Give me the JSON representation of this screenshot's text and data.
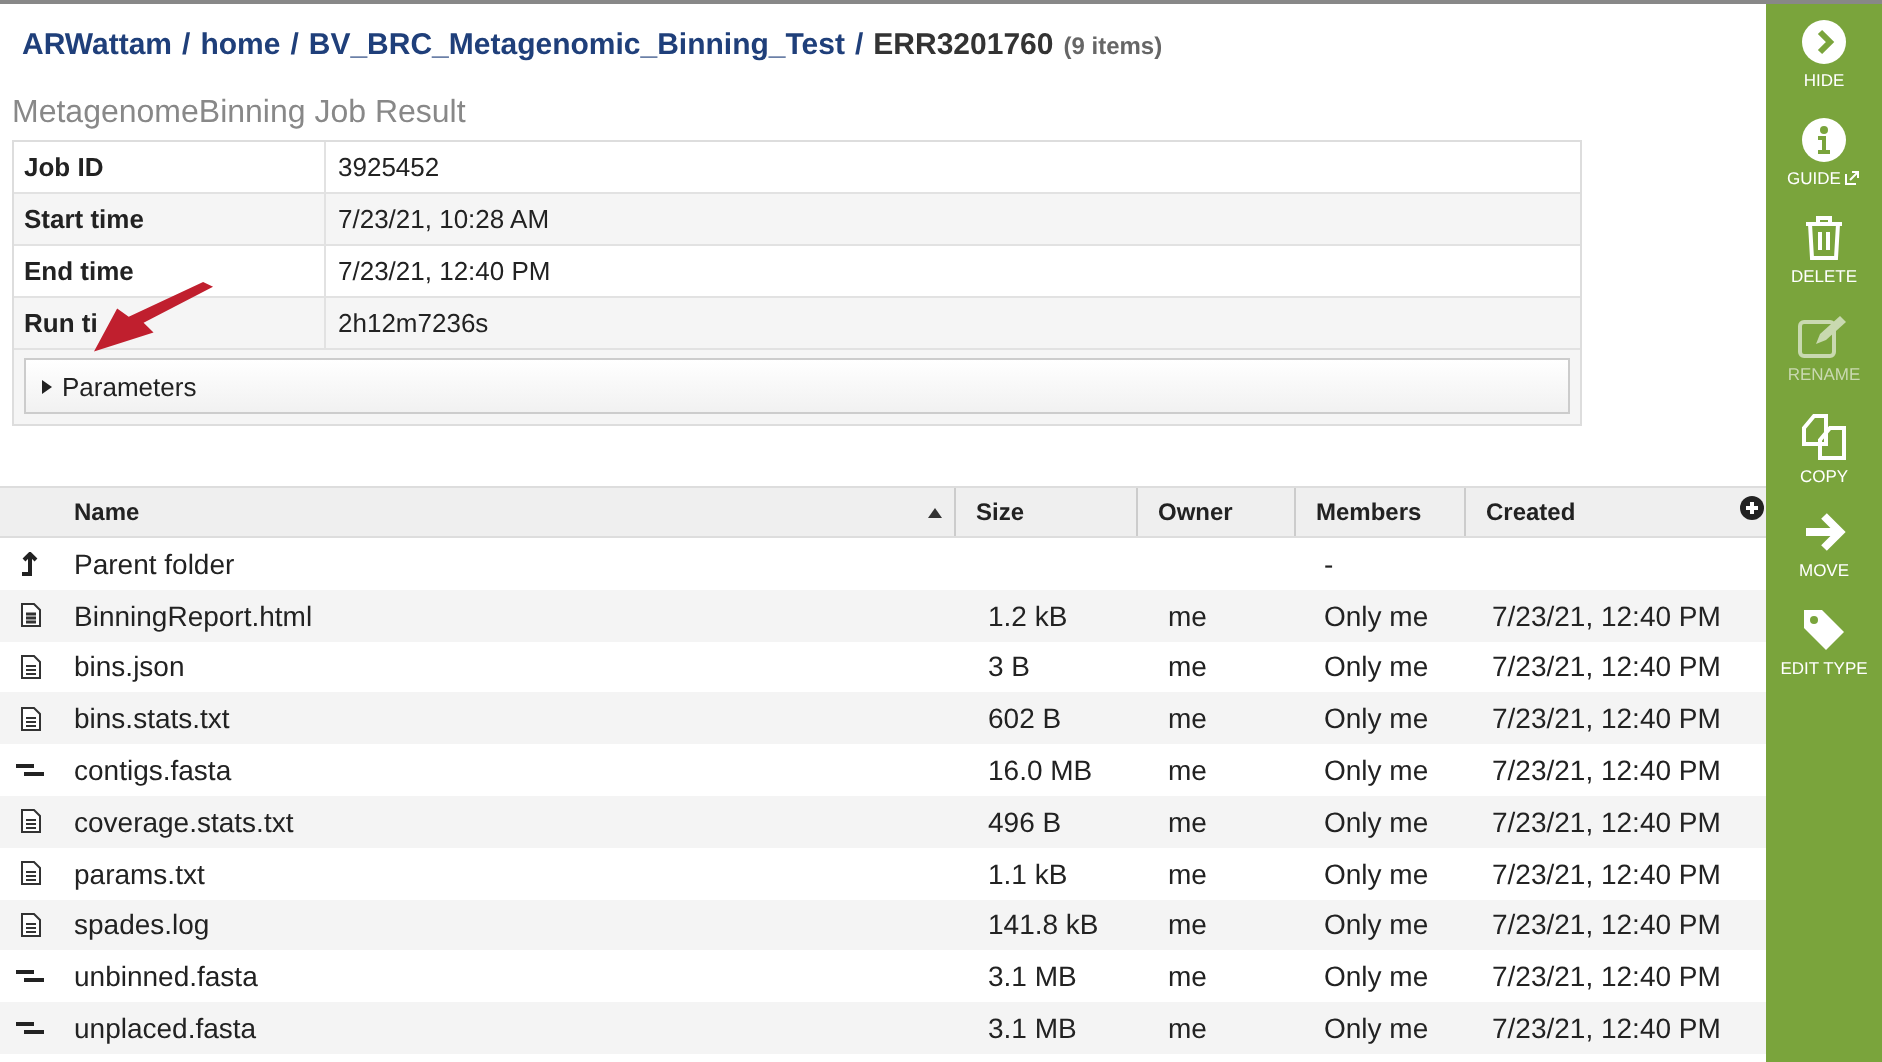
{
  "breadcrumb": {
    "links": [
      "ARWattam",
      "home",
      "BV_BRC_Metagenomic_Binning_Test"
    ],
    "separator": "/",
    "current": "ERR3201760",
    "count": "(9 items)"
  },
  "job_result": {
    "title": "MetagenomeBinning Job Result",
    "rows": [
      {
        "label": "Job ID",
        "value": "3925452"
      },
      {
        "label": "Start time",
        "value": "7/23/21, 10:28 AM"
      },
      {
        "label": "End time",
        "value": "7/23/21, 12:40 PM"
      },
      {
        "label": "Run ti",
        "value": "2h12m7236s"
      }
    ],
    "parameters": {
      "label": "Parameters",
      "expanded": false
    }
  },
  "file_table": {
    "columns": [
      {
        "label": "Name",
        "sorted": true
      },
      {
        "label": "Size",
        "sorted": false
      },
      {
        "label": "Owner",
        "sorted": false
      },
      {
        "label": "Members",
        "sorted": false
      },
      {
        "label": "Created",
        "sorted": false
      }
    ],
    "rows": [
      {
        "kind": "parent",
        "name": "Parent folder",
        "size": "",
        "owner": "",
        "members": "-",
        "created": ""
      },
      {
        "kind": "html",
        "name": "BinningReport.html",
        "size": "1.2 kB",
        "owner": "me",
        "members": "Only me",
        "created": "7/23/21, 12:40 PM"
      },
      {
        "kind": "doc",
        "name": "bins.json",
        "size": "3 B",
        "owner": "me",
        "members": "Only me",
        "created": "7/23/21, 12:40 PM"
      },
      {
        "kind": "doc",
        "name": "bins.stats.txt",
        "size": "602 B",
        "owner": "me",
        "members": "Only me",
        "created": "7/23/21, 12:40 PM"
      },
      {
        "kind": "contigs",
        "name": "contigs.fasta",
        "size": "16.0 MB",
        "owner": "me",
        "members": "Only me",
        "created": "7/23/21, 12:40 PM"
      },
      {
        "kind": "doc",
        "name": "coverage.stats.txt",
        "size": "496 B",
        "owner": "me",
        "members": "Only me",
        "created": "7/23/21, 12:40 PM"
      },
      {
        "kind": "doc",
        "name": "params.txt",
        "size": "1.1 kB",
        "owner": "me",
        "members": "Only me",
        "created": "7/23/21, 12:40 PM"
      },
      {
        "kind": "doc",
        "name": "spades.log",
        "size": "141.8 kB",
        "owner": "me",
        "members": "Only me",
        "created": "7/23/21, 12:40 PM"
      },
      {
        "kind": "contigs",
        "name": "unbinned.fasta",
        "size": "3.1 MB",
        "owner": "me",
        "members": "Only me",
        "created": "7/23/21, 12:40 PM"
      },
      {
        "kind": "contigs",
        "name": "unplaced.fasta",
        "size": "3.1 MB",
        "owner": "me",
        "members": "Only me",
        "created": "7/23/21, 12:40 PM"
      }
    ]
  },
  "action_bar": {
    "items": [
      {
        "kind": "hide",
        "label": "HIDE",
        "disabled": false,
        "external": false
      },
      {
        "kind": "guide",
        "label": "GUIDE",
        "disabled": false,
        "external": true
      },
      {
        "kind": "delete",
        "label": "DELETE",
        "disabled": false,
        "external": false
      },
      {
        "kind": "rename",
        "label": "RENAME",
        "disabled": true,
        "external": false
      },
      {
        "kind": "copy",
        "label": "COPY",
        "disabled": false,
        "external": false
      },
      {
        "kind": "move",
        "label": "MOVE",
        "disabled": false,
        "external": false
      },
      {
        "kind": "edittype",
        "label": "EDIT TYPE",
        "disabled": false,
        "external": false
      }
    ]
  }
}
